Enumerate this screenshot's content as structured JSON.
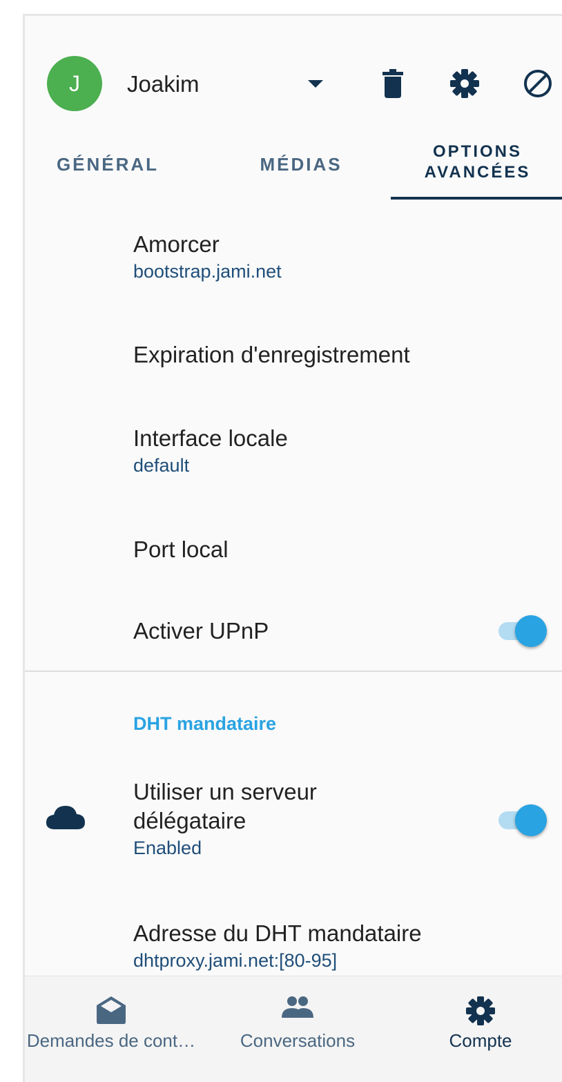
{
  "header": {
    "avatar_letter": "J",
    "account_name": "Joakim",
    "icons": [
      "trash-icon",
      "gear-icon",
      "block-icon"
    ]
  },
  "tabs": [
    {
      "label_line1": "GÉNÉRAL",
      "label_line2": "",
      "active": false
    },
    {
      "label_line1": "MÉDIAS",
      "label_line2": "",
      "active": false
    },
    {
      "label_line1": "OPTIONS",
      "label_line2": "AVANCÉES",
      "active": true
    }
  ],
  "settings": {
    "bootstrap": {
      "title": "Amorcer",
      "value": "bootstrap.jami.net"
    },
    "registration_expiry": {
      "title": "Expiration d'enregistrement"
    },
    "local_interface": {
      "title": "Interface locale",
      "value": "default"
    },
    "local_port": {
      "title": "Port local"
    },
    "upnp": {
      "title": "Activer UPnP",
      "enabled": true
    },
    "dht_section": {
      "header": "DHT mandataire"
    },
    "proxy_server": {
      "title_line1": "Utiliser un serveur",
      "title_line2": "délégataire",
      "value": "Enabled",
      "enabled": true,
      "icon": "cloud-icon"
    },
    "proxy_address": {
      "title": "Adresse du DHT mandataire",
      "value": "dhtproxy.jami.net:[80-95]"
    }
  },
  "bottom_nav": [
    {
      "label": "Demandes de cont…",
      "icon": "envelope-open-icon",
      "active": false
    },
    {
      "label": "Conversations",
      "icon": "people-icon",
      "active": false
    },
    {
      "label": "Compte",
      "icon": "gear-icon",
      "active": true
    }
  ],
  "colors": {
    "primary": "#12324f",
    "accent": "#29a3e2",
    "avatar": "#4caf50",
    "secondary_text": "#1f4e79"
  }
}
